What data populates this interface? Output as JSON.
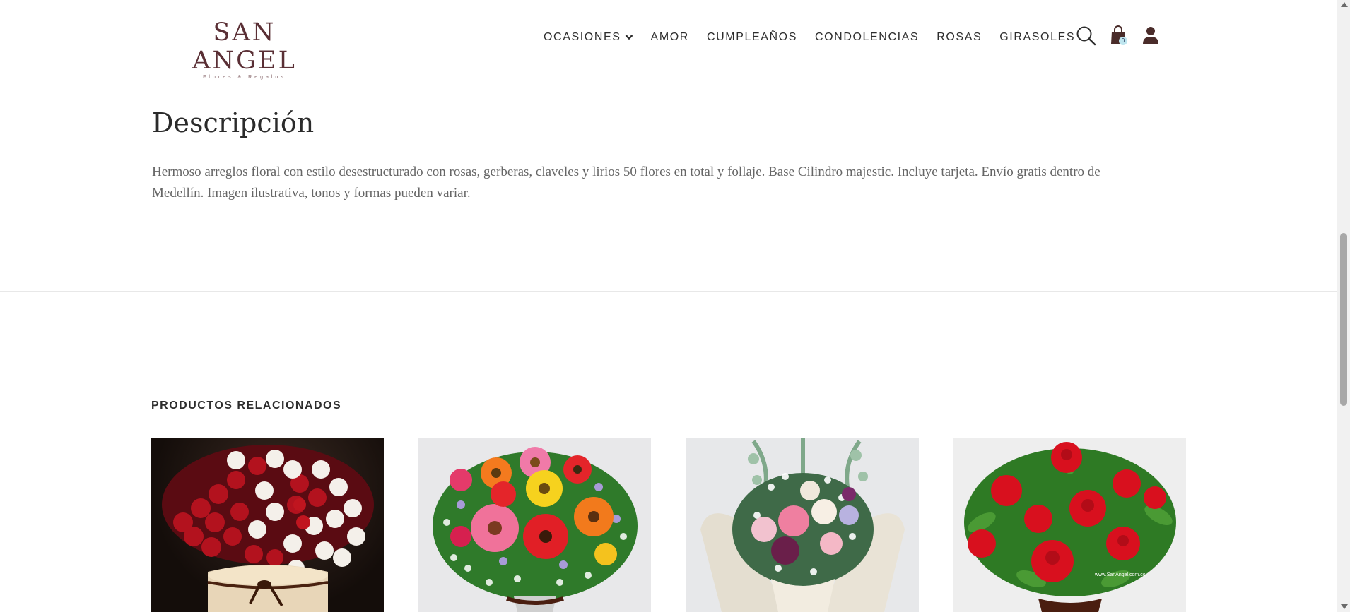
{
  "brand": {
    "name": "SAN ANGEL",
    "tagline": "Flores & Regalos",
    "color": "#5a2f35"
  },
  "nav": {
    "items": [
      {
        "label": "OCASIONES",
        "has_dropdown": true
      },
      {
        "label": "AMOR"
      },
      {
        "label": "CUMPLEAÑOS"
      },
      {
        "label": "CONDOLENCIAS"
      },
      {
        "label": "ROSAS"
      },
      {
        "label": "GIRASOLES"
      }
    ],
    "icons": [
      "search-icon",
      "cart-icon",
      "user-icon"
    ],
    "cart_count": "0"
  },
  "description": {
    "title": "Descripción",
    "text": "Hermoso arreglos floral con estilo desestructurado con rosas, gerberas, claveles y lirios 50 flores en total y follaje. Base Cilindro majestic. Incluye tarjeta. Envío gratis dentro de Medellín. Imagen ilustrativa, tonos y formas pueden variar."
  },
  "related": {
    "title": "PRODUCTOS RELACIONADOS",
    "products": [
      {
        "image": "red-and-white-roses-box",
        "watermark": ""
      },
      {
        "image": "mixed-gerberas-arrangement",
        "watermark": ""
      },
      {
        "image": "pastel-bouquet-in-paper",
        "watermark": ""
      },
      {
        "image": "red-roses-arrangement",
        "watermark": "www.SanAngel.com.co"
      }
    ]
  }
}
